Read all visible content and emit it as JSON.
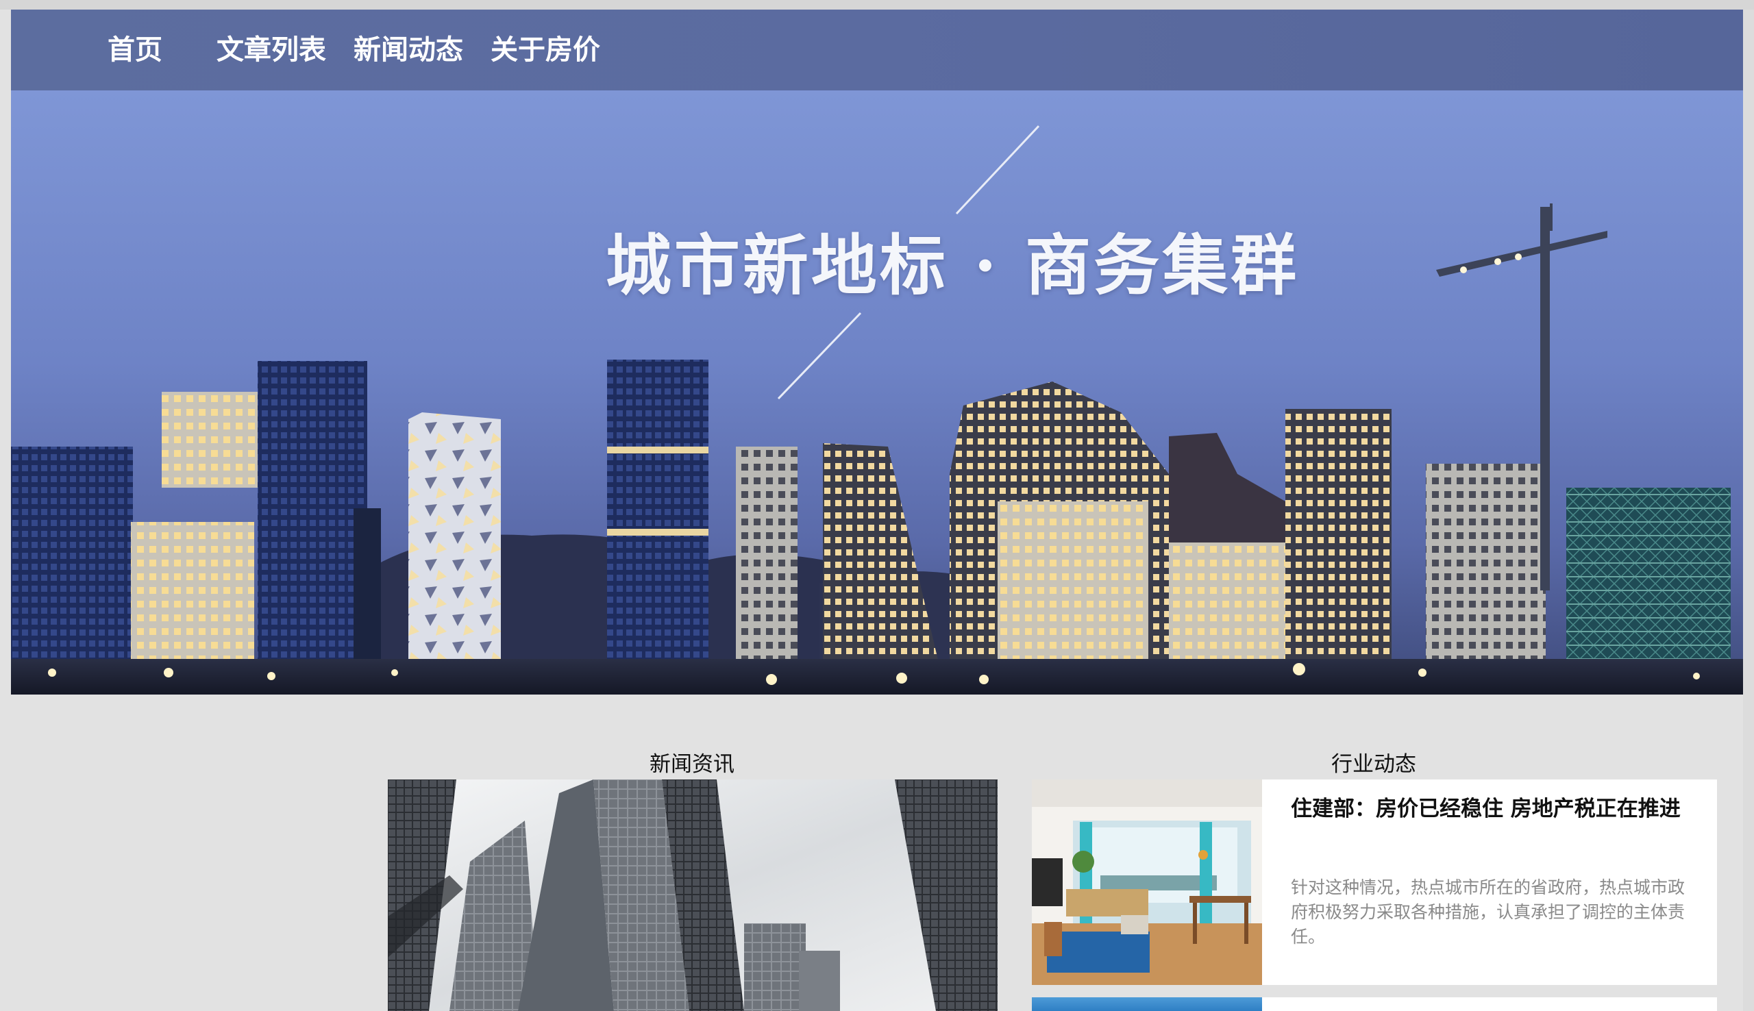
{
  "nav": {
    "items": [
      {
        "label": "首页"
      },
      {
        "label": "文章列表"
      },
      {
        "label": "新闻动态"
      },
      {
        "label": "关于房价"
      }
    ]
  },
  "hero": {
    "title": "城市新地标 · 商务集群"
  },
  "sections": {
    "news_heading": "新闻资讯",
    "industry_heading": "行业动态"
  },
  "article": {
    "title": "住建部：房价已经稳住 房地产税正在推进",
    "summary": "针对这种情况，热点城市所在的省政府，热点城市政府积极努力采取各种措施，认真承担了调控的主体责任。"
  },
  "colors": {
    "nav_bg": "#5b6ba0",
    "page_bg": "#e2e2e2",
    "card_bg": "#ffffff",
    "summary_text": "#8a8a8a"
  }
}
